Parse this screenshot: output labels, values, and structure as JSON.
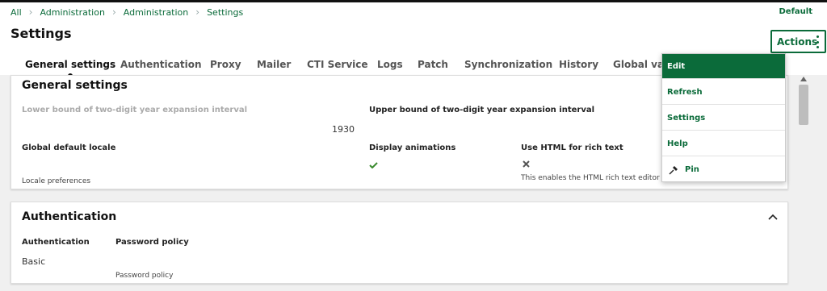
{
  "breadcrumb": [
    "All",
    "Administration",
    "Administration",
    "Settings"
  ],
  "env": {
    "selected": "Default"
  },
  "page": {
    "title": "Settings"
  },
  "actions": {
    "label": "Actions"
  },
  "tabs": [
    {
      "label": "General settings",
      "active": true
    },
    {
      "label": "Authentication"
    },
    {
      "label": "Proxy"
    },
    {
      "label": "Mailer"
    },
    {
      "label": "CTI Service"
    },
    {
      "label": "Logs"
    },
    {
      "label": "Patch"
    },
    {
      "label": "Synchronization"
    },
    {
      "label": "History"
    },
    {
      "label": "Global vari"
    }
  ],
  "general": {
    "title": "General settings",
    "lower_bound_label": "Lower bound of two-digit year expansion interval",
    "upper_bound_label": "Upper bound of two-digit year expansion interval",
    "lower_bound_value": "1930",
    "locale_label": "Global default locale",
    "locale_hint": "Locale preferences",
    "animations_label": "Display animations",
    "html_label": "Use HTML for rich text",
    "html_hint": "This enables the HTML rich text editor f"
  },
  "authentication": {
    "title": "Authentication",
    "auth_label": "Authentication",
    "auth_value": "Basic",
    "password_label": "Password policy",
    "password_hint": "Password policy"
  },
  "menu": {
    "items": [
      "Edit",
      "Refresh",
      "Settings",
      "Help",
      "Pin"
    ]
  },
  "colors": {
    "accent": "#0b6b3a"
  }
}
